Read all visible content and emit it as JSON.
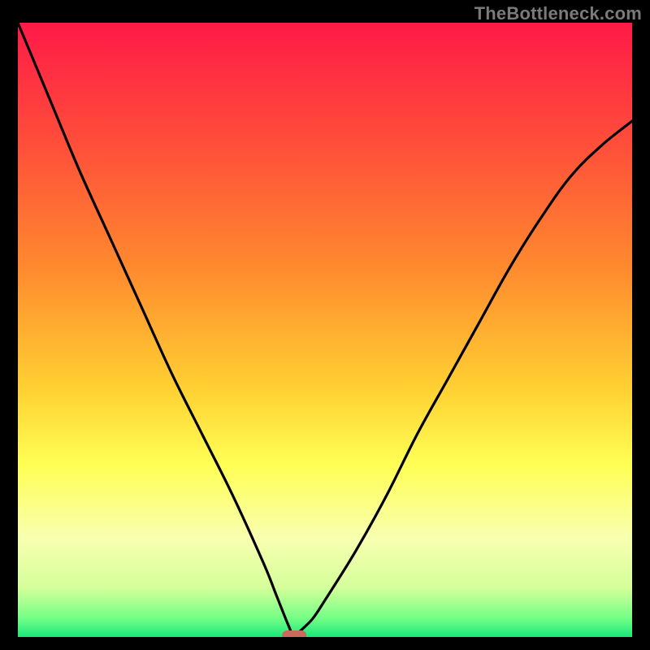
{
  "watermark": "TheBottleneck.com",
  "colors": {
    "background": "#000000",
    "watermark": "#7a7a7a",
    "curve": "#000000",
    "marker_fill": "#c96a5d",
    "gradient_stops": [
      {
        "offset": 0.0,
        "color": "#ff1a47"
      },
      {
        "offset": 0.2,
        "color": "#ff4f3a"
      },
      {
        "offset": 0.4,
        "color": "#ff8a2e"
      },
      {
        "offset": 0.6,
        "color": "#ffd233"
      },
      {
        "offset": 0.72,
        "color": "#ffff55"
      },
      {
        "offset": 0.84,
        "color": "#f8ffb0"
      },
      {
        "offset": 0.92,
        "color": "#d4ff9a"
      },
      {
        "offset": 0.97,
        "color": "#73ff86"
      },
      {
        "offset": 1.0,
        "color": "#19e87a"
      }
    ]
  },
  "chart_data": {
    "type": "line",
    "title": "",
    "xlabel": "",
    "ylabel": "",
    "xlim": [
      0,
      100
    ],
    "ylim": [
      0,
      100
    ],
    "legend": false,
    "grid": false,
    "marker_at_min": {
      "x": 45,
      "y": 0
    },
    "series": [
      {
        "name": "bottleneck-curve",
        "x": [
          0,
          5,
          10,
          15,
          20,
          25,
          30,
          35,
          40,
          42,
          44,
          45,
          46,
          48,
          50,
          55,
          60,
          65,
          70,
          75,
          80,
          85,
          90,
          95,
          100
        ],
        "y": [
          100,
          88,
          76,
          65,
          54,
          43,
          33,
          23,
          12,
          7,
          2,
          0,
          1,
          3,
          6,
          14,
          23,
          33,
          42,
          51,
          60,
          68,
          75,
          80,
          84
        ]
      }
    ]
  }
}
